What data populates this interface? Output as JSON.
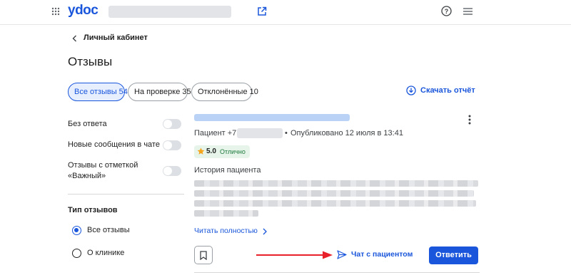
{
  "header": {
    "logo_text": "ydoc",
    "menu_icon": "apps-grid-icon",
    "open_external_icon": "open-in-new-icon",
    "help_icon": "help-circle-icon",
    "hamburger_icon": "hamburger-menu-icon"
  },
  "breadcrumb": {
    "back_label": "Личный кабинет"
  },
  "page": {
    "title": "Отзывы"
  },
  "tabs": [
    {
      "label": "Все отзывы 54",
      "active": true
    },
    {
      "label": "На проверке 35",
      "active": false
    },
    {
      "label": "Отклонённые 10",
      "active": false
    }
  ],
  "download_report": {
    "label": "Скачать отчёт",
    "icon": "download-circle-icon"
  },
  "filters": {
    "toggles": [
      {
        "label": "Без ответа"
      },
      {
        "label": "Новые сообщения в чате"
      },
      {
        "label": "Отзывы с отметкой «Важный»"
      }
    ],
    "review_type_title": "Тип отзывов",
    "review_types": [
      {
        "label": "Все отзывы",
        "checked": true
      },
      {
        "label": "О клинике",
        "checked": false
      }
    ]
  },
  "review": {
    "patient_prefix": "Пациент +7",
    "published": "Опубликовано 12 июля в 13:41",
    "rating_value": "5.0",
    "rating_label": "Отлично",
    "history_title": "История пациента",
    "read_more": "Читать полностью",
    "chat_label": "Чат с пациентом",
    "reply_label": "Ответить",
    "accent_color": "#1a56db"
  }
}
